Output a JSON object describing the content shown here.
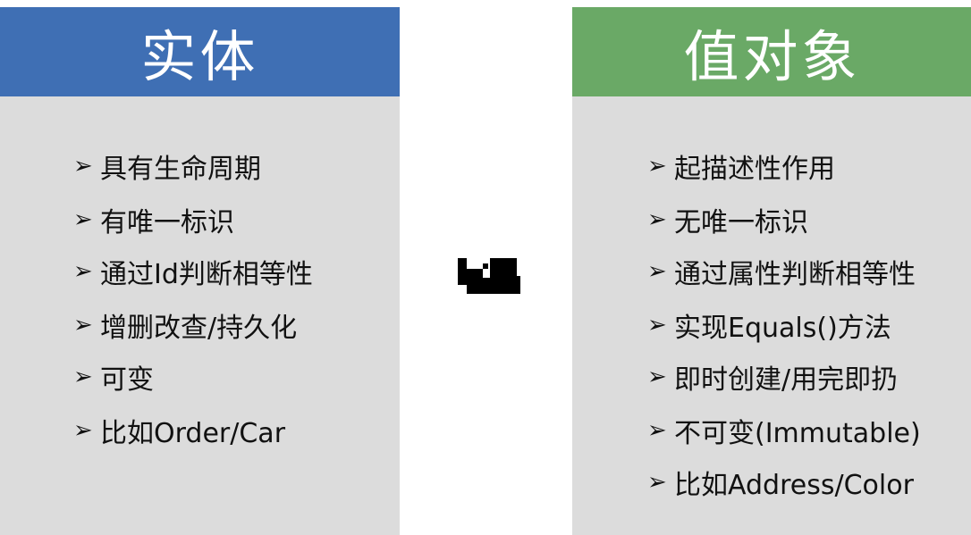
{
  "entity": {
    "title": "实体",
    "items": [
      "具有生命周期",
      "有唯一标识",
      "通过Id判断相等性",
      "增删改查/持久化",
      "可变",
      "比如Order/Car"
    ]
  },
  "value_object": {
    "title": "值对象",
    "items": [
      "起描述性作用",
      "无唯一标识",
      "通过属性判断相等性",
      "实现Equals()方法",
      "即时创建/用完即扔",
      "不可变(Immutable)",
      "比如Address/Color"
    ]
  },
  "bullet_glyph": "➢",
  "colors": {
    "entity_header": "#3f6fb4",
    "value_object_header": "#6aa966",
    "panel_background": "#dcdcdc"
  }
}
